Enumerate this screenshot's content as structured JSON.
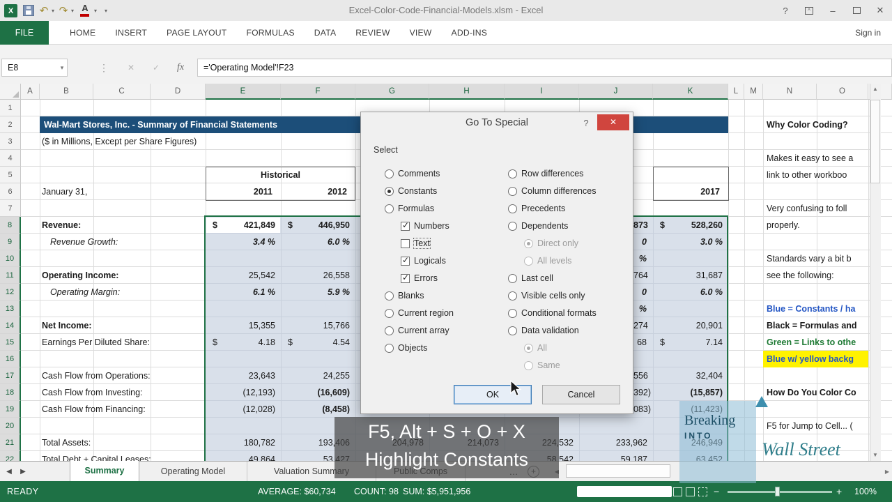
{
  "colors": {
    "excel_green": "#217346",
    "header_blue": "#1C4E79",
    "selection_fill": "#D9E0EA",
    "blue_font": "#2456C4",
    "green_font": "#1E7A34",
    "highlight_yellow": "#FF F200",
    "dialog_close_red": "#D0453E",
    "logo_teal": "#2E7D8A"
  },
  "window": {
    "title": "Excel-Color-Code-Financial-Models.xlsm - Excel",
    "sign_in": "Sign in"
  },
  "icons": {
    "dropdown": "▾",
    "dots": "⋮",
    "cancel": "✕",
    "enter": "✓",
    "fx": "fx",
    "help": "?",
    "min": "–",
    "close": "✕",
    "undo": "↶",
    "redo": "↷",
    "left": "◀",
    "right": "▶",
    "up": "▲",
    "down": "▼",
    "more": "…",
    "add": "+",
    "zoom_out": "−",
    "zoom_in": "+",
    "font_color": "A",
    "excel": "X"
  },
  "ribbon": {
    "tabs": [
      "FILE",
      "HOME",
      "INSERT",
      "PAGE LAYOUT",
      "FORMULAS",
      "DATA",
      "REVIEW",
      "VIEW",
      "ADD-INS"
    ]
  },
  "formula_bar": {
    "name_box": "E8",
    "formula": "='Operating Model'!F23"
  },
  "grid": {
    "cols": [
      "A",
      "B",
      "C",
      "D",
      "E",
      "F",
      "G",
      "H",
      "I",
      "J",
      "K",
      "L",
      "M",
      "N",
      "O"
    ],
    "rows": [
      "1",
      "2",
      "3",
      "4",
      "5",
      "6",
      "7",
      "8",
      "9",
      "10",
      "11",
      "12",
      "13",
      "14",
      "15",
      "16",
      "17",
      "18",
      "19",
      "20",
      "21",
      "22"
    ]
  },
  "ws": {
    "title": "Wal-Mart Stores, Inc. - Summary of Financial Statements",
    "subtitle": "($ in Millions, Except per Share Figures)",
    "historical": "Historical",
    "date_label": "January 31,",
    "y2011": "2011",
    "y2012": "2012",
    "y2017": "2017",
    "rows": [
      {
        "row": "8",
        "label": "Revenue:",
        "e_cur": "$",
        "e": "421,849",
        "f_cur": "$",
        "f": "446,950",
        "j": "873",
        "k_cur": "$",
        "k": "528,260"
      },
      {
        "row": "9",
        "label": "Revenue Growth:",
        "e": "3.4 %",
        "f": "6.0 %",
        "j": "0 %",
        "k": "3.0 %"
      },
      {
        "row": "11",
        "label": "Operating Income:",
        "e": "25,542",
        "f": "26,558",
        "j": "764",
        "k": "31,687"
      },
      {
        "row": "12",
        "label": "Operating Margin:",
        "e": "6.1 %",
        "f": "5.9 %",
        "j": "0 %",
        "k": "6.0 %"
      },
      {
        "row": "14",
        "label": "Net Income:",
        "e": "15,355",
        "f": "15,766",
        "j": "274",
        "k": "20,901"
      },
      {
        "row": "15",
        "label": "Earnings Per Diluted Share:",
        "e_cur": "$",
        "e": "4.18",
        "f_cur": "$",
        "f": "4.54",
        "j": "68",
        "k_cur": "$",
        "k": "7.14"
      },
      {
        "row": "17",
        "label": "Cash Flow from Operations:",
        "e": "23,643",
        "f": "24,255",
        "j": "556",
        "k": "32,404"
      },
      {
        "row": "18",
        "label": "Cash Flow from Investing:",
        "e": "(12,193)",
        "f": "(16,609)",
        "j": "392)",
        "k": "(15,857)"
      },
      {
        "row": "19",
        "label": "Cash Flow from Financing:",
        "e": "(12,028)",
        "f": "(8,458)",
        "j": "083)",
        "k": "(11,423)"
      },
      {
        "row": "21",
        "label": "Total Assets:",
        "e": "180,782",
        "f": "193,406",
        "g": "204,978",
        "h": "214,073",
        "i": "224,532",
        "j": "233,962",
        "k": "246,949"
      },
      {
        "row": "22",
        "label": "Total Debt + Capital Leases:",
        "e": "49,864",
        "f": "53,427",
        "i": "58,542",
        "j": "59,187",
        "k": "63,452"
      }
    ]
  },
  "notes": {
    "heading1": "Why Color Coding?",
    "line1a": "Makes it easy to see a",
    "line1b": "link to other workboo",
    "line2a": "Very confusing to foll",
    "line2b": "properly.",
    "line3a": "Standards vary a bit b",
    "line3b": "see the following:",
    "rule_blue": "Blue = Constants / ha",
    "rule_black": "Black = Formulas and",
    "rule_green": "Green = Links to othe",
    "rule_highlight": "Blue w/ yellow backg",
    "heading2": "How Do You Color Co",
    "tip1": "F5 for Jump to Cell... ("
  },
  "dialog": {
    "title": "Go To Special",
    "select_label": "Select",
    "left": [
      "Comments",
      "Constants",
      "Formulas",
      "Numbers",
      "Text",
      "Logicals",
      "Errors",
      "Blanks",
      "Current region",
      "Current array",
      "Objects"
    ],
    "right": [
      "Row differences",
      "Column differences",
      "Precedents",
      "Dependents",
      "Direct only",
      "All levels",
      "Last cell",
      "Visible cells only",
      "Conditional formats",
      "Data validation",
      "All",
      "Same"
    ],
    "selected_option": "Constants",
    "numbers_checked": true,
    "text_checked": false,
    "logicals_checked": true,
    "errors_checked": true,
    "ok": "OK",
    "cancel": "Cancel"
  },
  "overlay": {
    "line1": "F5, Alt + S + O + X",
    "line2": "Highlight Constants"
  },
  "logo": {
    "w1": "Breaking",
    "w2": "INTO",
    "w3": "Wall Street"
  },
  "tabs": {
    "sheets": [
      "Summary",
      "Operating Model",
      "Valuation Summary",
      "Public Comps"
    ],
    "active": "Summary"
  },
  "status": {
    "mode": "READY",
    "average": "AVERAGE: $60,734",
    "count": "COUNT: 98",
    "sum": "SUM: $5,951,956",
    "zoom": "100%"
  }
}
